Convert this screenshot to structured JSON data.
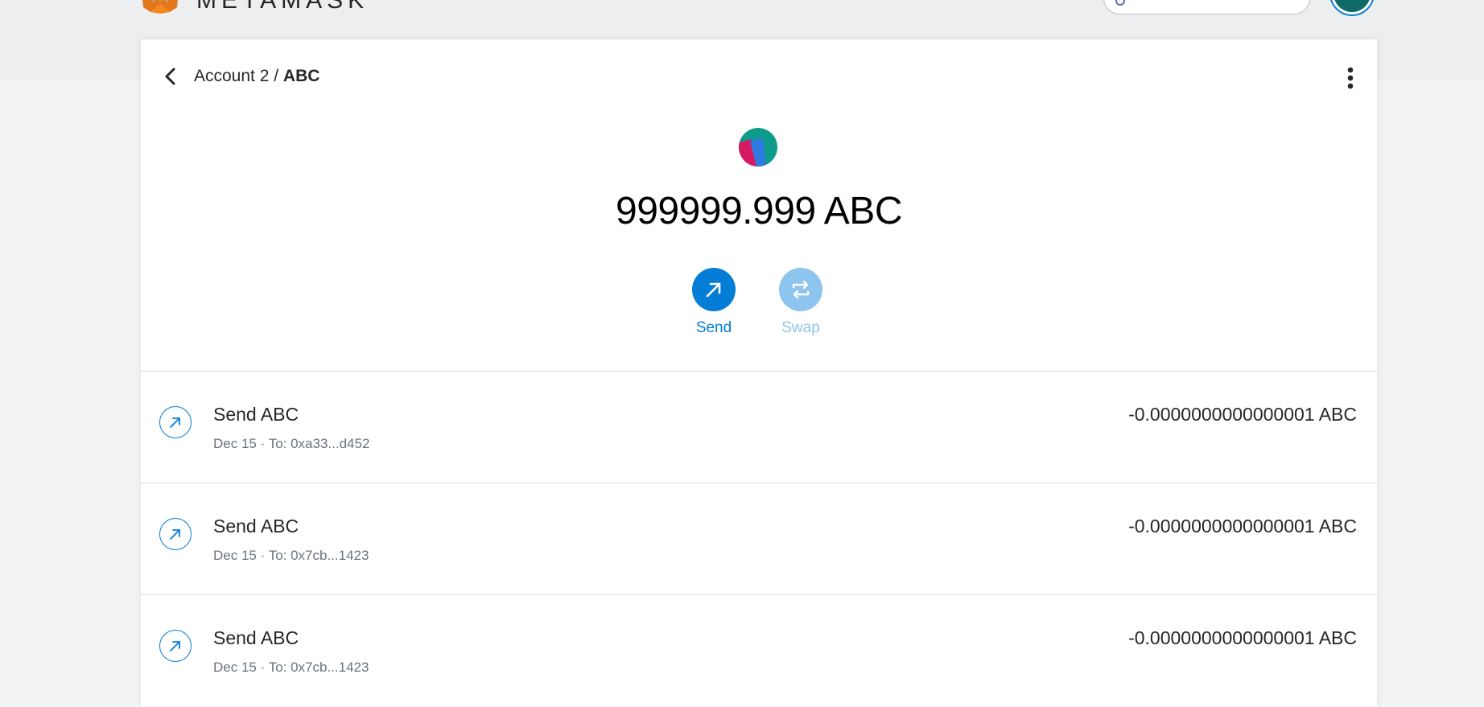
{
  "app": {
    "brand": "METAMASK"
  },
  "header": {
    "account": "Account 2 / ",
    "asset": "ABC"
  },
  "token": {
    "balance": "999999.999 ABC"
  },
  "actions": {
    "send_label": "Send",
    "swap_label": "Swap"
  },
  "transactions": [
    {
      "title": "Send ABC",
      "date": "Dec 15",
      "to": "To: 0xa33...d452",
      "amount": "-0.0000000000000001 ABC"
    },
    {
      "title": "Send ABC",
      "date": "Dec 15",
      "to": "To: 0x7cb...1423",
      "amount": "-0.0000000000000001 ABC"
    },
    {
      "title": "Send ABC",
      "date": "Dec 15",
      "to": "To: 0x7cb...1423",
      "amount": "-0.0000000000000001 ABC"
    }
  ],
  "colors": {
    "primary": "#037dd6",
    "primary_disabled": "#8ec5ee",
    "text": "#24272a",
    "muted": "#6a737d",
    "background": "#f2f3f4",
    "divider": "#d6d9dc"
  },
  "icons": {
    "back": "chevron-left-icon",
    "menu": "kebab-menu-icon",
    "send": "arrow-up-right-icon",
    "swap": "swap-arrows-icon",
    "token": "token-identicon",
    "transaction": "arrow-up-right-icon"
  }
}
